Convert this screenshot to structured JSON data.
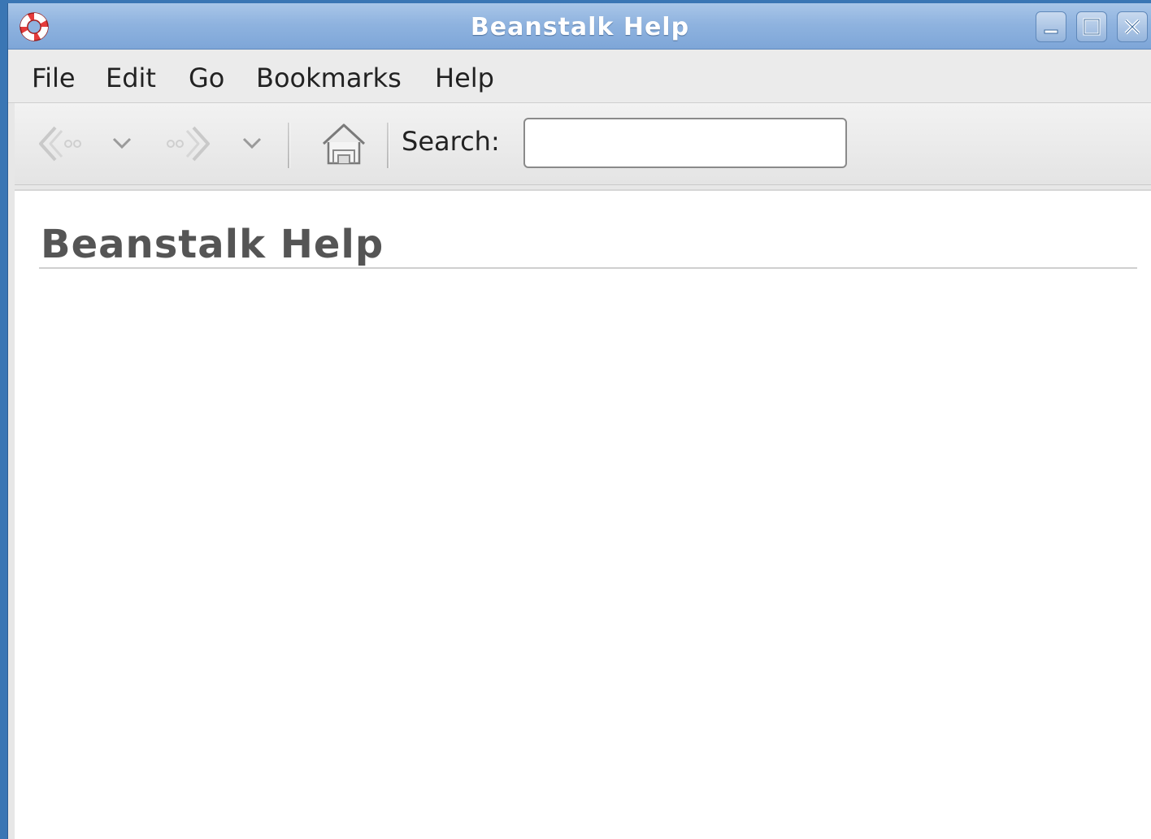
{
  "window": {
    "title": "Beanstalk Help"
  },
  "menubar": {
    "items": [
      {
        "label": "File"
      },
      {
        "label": "Edit"
      },
      {
        "label": "Go"
      },
      {
        "label": "Bookmarks"
      },
      {
        "label": "Help"
      }
    ]
  },
  "toolbar": {
    "back_icon": "back-arrow-icon",
    "back_menu_icon": "chevron-down-icon",
    "forward_icon": "forward-arrow-icon",
    "forward_menu_icon": "chevron-down-icon",
    "home_icon": "home-icon",
    "search_label": "Search:",
    "search_value": ""
  },
  "content": {
    "heading": "Beanstalk Help"
  },
  "colors": {
    "titlebar": "#8fb3df",
    "desktop": "#3a76b4",
    "heading": "#555555"
  }
}
